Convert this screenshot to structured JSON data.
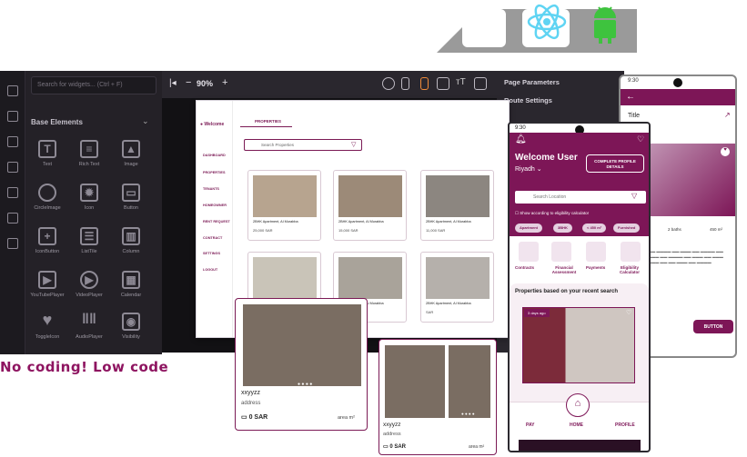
{
  "editor": {
    "search_placeholder": "Search for widgets... (Ctrl + F)",
    "section_title": "Base Elements",
    "widgets": [
      "Text",
      "Rich Text",
      "Image",
      "CircleImage",
      "Icon",
      "Button",
      "IconButton",
      "ListTile",
      "Column",
      "YouTubePlayer",
      "VideoPlayer",
      "Calendar",
      "ToggleIcon",
      "AudioPlayer",
      "Visibility"
    ]
  },
  "toolbar": {
    "zoom": "90%",
    "panel_title": "Page Parameters",
    "panel_sub": "Route Settings"
  },
  "desktop": {
    "welcome": "Welcome",
    "tab": "PROPERTIES",
    "search": "Search Properties",
    "nav": [
      "DASHBOARD",
      "PROPERTIES",
      "TENANTS",
      "HOMEOWNER",
      "RENT REQUEST",
      "CONTRACT",
      "SETTINGS",
      "LOGOUT"
    ],
    "cards": [
      {
        "name": "2BHK Apartment, Al Murabba",
        "price": "25,000 SAR"
      },
      {
        "name": "2BHK Apartment, Al Murabba",
        "price": "15,000 SAR"
      },
      {
        "name": "2BHK Apartment, Al Murabba",
        "price": "11,000 SAR"
      },
      {
        "name": "2BHK Apartment, Al Murabba",
        "price": "SAR"
      },
      {
        "name": "2BHK Apartment, Al Murabba",
        "price": "SAR"
      },
      {
        "name": "2BHK Apartment, Al Murabba",
        "price": "SAR"
      }
    ]
  },
  "overlay": {
    "card1": {
      "name": "xxyyzz",
      "address": "address",
      "price": "0 SAR",
      "area": "area m²"
    },
    "card2": {
      "name": "xxyyzz",
      "address": "address",
      "price": "0 SAR",
      "area": "area m²"
    }
  },
  "phone": {
    "time": "9:30",
    "welcome": "Welcome User",
    "city": "Riyadh",
    "complete_btn": "COMPLETE PROFILE DETAILS",
    "search": "Search Location",
    "checkbox": "Show according to eligibility calculator",
    "chips": [
      "Apartment",
      "3BHK",
      "< 450 m²",
      "Furnished"
    ],
    "tiles": [
      "Contracts",
      "Financial Assessment",
      "Payments",
      "Eligibility Calculator"
    ],
    "recent_title": "Properties based on your recent search",
    "badge": "3 days ago",
    "nav": [
      "PAY",
      "HOME",
      "PROFILE"
    ]
  },
  "rphone": {
    "time": "9:30",
    "title": "Title",
    "button": "BUTTON",
    "baths": "2 baths",
    "area": "450 m²"
  },
  "tagline": "No coding! Low code"
}
